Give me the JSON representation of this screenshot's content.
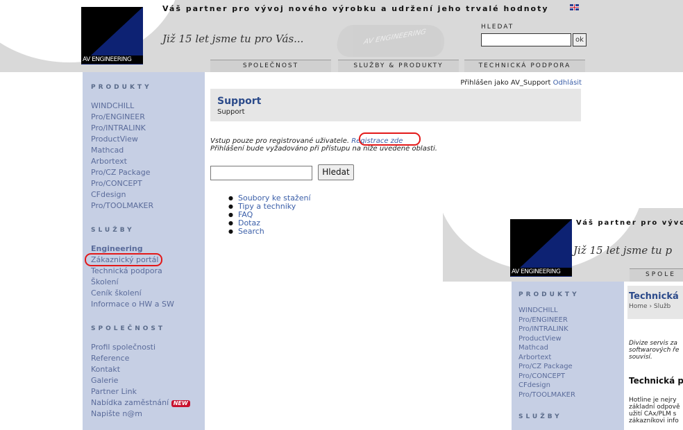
{
  "header": {
    "tagline": "Váš partner pro vývoj nového výrobku a udržení jeho trvalé hodnoty",
    "slogan": "Již 15 let jsme tu pro Vás...",
    "logo_text": "AV ENGINEERING",
    "car_text": "AV ENGINEERING",
    "search_label": "HLEDAT",
    "search_value": "",
    "ok_label": "ok"
  },
  "tabs": [
    "SPOLEČNOST",
    "SLUŽBY & PRODUKTY",
    "TECHNICKÁ PODPORA"
  ],
  "sidebar": {
    "produkty_title": "PRODUKTY",
    "produkty": [
      "WINDCHILL",
      "Pro/ENGINEER",
      "Pro/INTRALINK",
      "ProductView",
      "Mathcad",
      "Arbortext",
      "Pro/CZ Package",
      "Pro/CONCEPT",
      "CFdesign",
      "Pro/TOOLMAKER"
    ],
    "sluzby_title": "SLUŽBY",
    "sluzby": [
      "Engineering",
      "Zákaznický portál",
      "Technická podpora",
      "Školení",
      "Ceník školení",
      "Informace o HW a SW"
    ],
    "spolecnost_title": "SPOLEČNOST",
    "spolecnost": [
      "Profil společnosti",
      "Reference",
      "Kontakt",
      "Galerie",
      "Partner Link",
      "Nabídka zaměstnání",
      "Napište n@m"
    ],
    "new_badge": "NEW"
  },
  "content": {
    "login_text": "Přihlášen jako AV_Support",
    "logout_label": "Odhlásit",
    "title": "Support",
    "subtitle": "Support",
    "note_line1": "Vstup pouze pro registrované uživatele.",
    "register_link": "Registrace zde",
    "note_line2": "Přihlášení bude vyžadováno při přístupu na níže uvedené oblasti.",
    "search_value": "",
    "search_button": "Hledat",
    "links": [
      "Soubory ke stažení",
      "Tipy a techniky",
      "FAQ",
      "Dotaz",
      "Search"
    ]
  },
  "overlay": {
    "tagline": "Váš partner pro vývo",
    "slogan": "Již 15 let jsme tu p",
    "logo_text": "AV ENGINEERING",
    "tab": "SPOLE",
    "produkty_title": "PRODUKTY",
    "produkty": [
      "WINDCHILL",
      "Pro/ENGINEER",
      "Pro/INTRALINK",
      "ProductView",
      "Mathcad",
      "Arbortext",
      "Pro/CZ Package",
      "Pro/CONCEPT",
      "CFdesign",
      "Pro/TOOLMAKER"
    ],
    "sluzby_title": "SLUŽBY",
    "box_title": "Technická",
    "box_breadcrumb": "Home › Služb",
    "para1": [
      "Divize servis za",
      "softwarových ře",
      "souvisí."
    ],
    "heading": "Technická p",
    "para2": [
      "Hotline je nejry",
      "základní odpově",
      "užití CAx/PLM s",
      "zákazníkovi info"
    ]
  },
  "colors": {
    "accent": "#2b4a8a",
    "link": "#3a5ea8",
    "sidebar_bg": "#c6cfe4",
    "highlight": "#e31818",
    "logo_blue": "#0d2273"
  }
}
